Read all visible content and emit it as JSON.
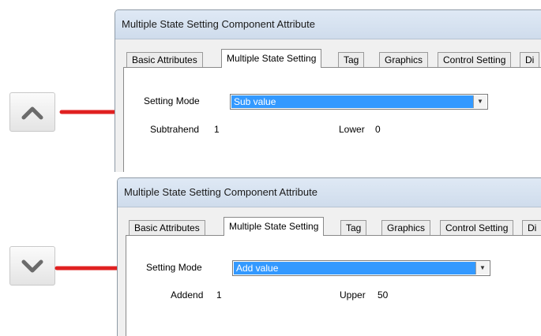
{
  "windows": [
    {
      "title": "Multiple State Setting Component Attribute",
      "tabs": [
        "Basic Attributes",
        "Multiple State Setting",
        "Tag",
        "Graphics",
        "Control Setting",
        "Di"
      ],
      "active_tab": 1,
      "setting_mode_label": "Setting Mode",
      "setting_mode_value": "Sub value",
      "field1_label": "Subtrahend",
      "field1_value": "1",
      "field2_label": "Lower",
      "field2_value": "0"
    },
    {
      "title": "Multiple State Setting Component Attribute",
      "tabs": [
        "Basic Attributes",
        "Multiple State Setting",
        "Tag",
        "Graphics",
        "Control Setting",
        "Di"
      ],
      "active_tab": 1,
      "setting_mode_label": "Setting Mode",
      "setting_mode_value": "Add value",
      "field1_label": "Addend",
      "field1_value": "1",
      "field2_label": "Upper",
      "field2_value": "50"
    }
  ],
  "icons": {
    "up": "chevron-up-icon",
    "down": "chevron-down-icon",
    "dropdown": "triangle-down-icon",
    "pointer": "red-arrow-icon"
  },
  "colors": {
    "selection": "#3399ff",
    "arrow": "#e02020"
  }
}
